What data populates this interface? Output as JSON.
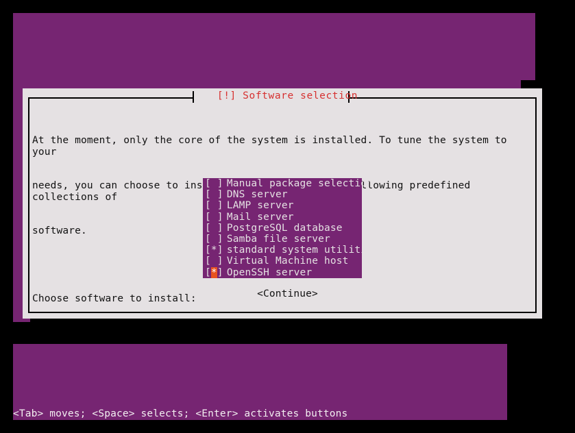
{
  "theme": {
    "terminal_bg": "#762572",
    "dialog_bg": "#e5e1e3",
    "frame": "#000000",
    "title_color": "#d63030",
    "text_color": "#111111",
    "list_text": "#e5e1e3",
    "focus_mark_bg": "#e8521f",
    "focus_mark_fg": "#ffffff",
    "status_color": "#f2eef0"
  },
  "dialog": {
    "title": "[!] Software selection",
    "paragraphs": [
      "At the moment, only the core of the system is installed. To tune the system to your",
      "needs, you can choose to install one or more of the following predefined collections of",
      "software."
    ],
    "prompt": "Choose software to install:",
    "items": [
      {
        "mark": " ",
        "label": "Manual package selection",
        "checked": false,
        "focused": false
      },
      {
        "mark": " ",
        "label": "DNS server",
        "checked": false,
        "focused": false
      },
      {
        "mark": " ",
        "label": "LAMP server",
        "checked": false,
        "focused": false
      },
      {
        "mark": " ",
        "label": "Mail server",
        "checked": false,
        "focused": false
      },
      {
        "mark": " ",
        "label": "PostgreSQL database",
        "checked": false,
        "focused": false
      },
      {
        "mark": " ",
        "label": "Samba file server",
        "checked": false,
        "focused": false
      },
      {
        "mark": "*",
        "label": "standard system utilities",
        "checked": true,
        "focused": false
      },
      {
        "mark": " ",
        "label": "Virtual Machine host",
        "checked": false,
        "focused": false
      },
      {
        "mark": "*",
        "label": "OpenSSH server",
        "checked": true,
        "focused": true
      }
    ],
    "bracket_open": "[",
    "bracket_close": "]",
    "continue_label": "<Continue>"
  },
  "status_bar": {
    "text": "<Tab> moves; <Space> selects; <Enter> activates buttons"
  }
}
